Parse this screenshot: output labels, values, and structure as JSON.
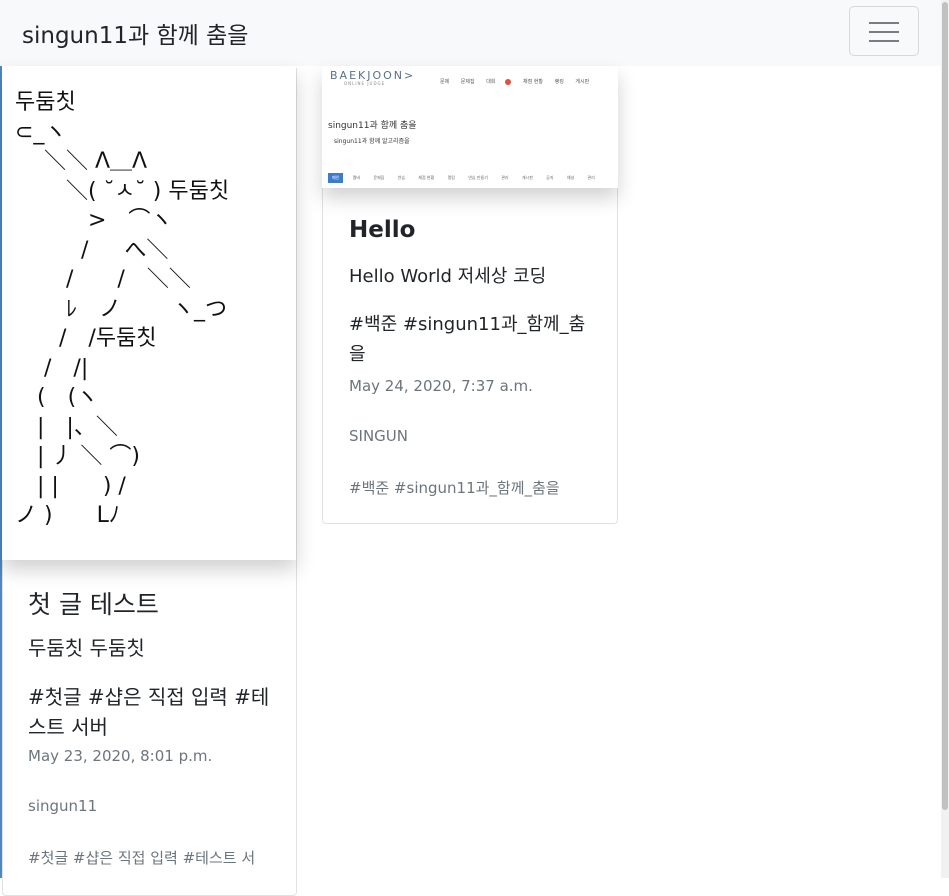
{
  "navbar": {
    "brand": "singun11과 함께 춤을",
    "toggler_icon": "hamburger-icon"
  },
  "posts": [
    {
      "image_text": "두둠칫\n⊂_ヽ\n　 ＼＼ Λ＿Λ\n　　 ＼( ˘ㅅ˘ ) 두둠칫\n　　　 >　⌒ヽ\n　　　/ 　 へ＼\n　　 /　　/　＼＼\n　　 ﾚ　ノ　　 ヽ_つ\n　　/　/두둠칫\n　 /　/|\n　(　(ヽ\n　|　|、＼\n　| 丿 ＼ ⌒)\n　| |　　) /\nノ )　　Lﾉ",
      "title": "첫 글 테스트",
      "subtitle": "두둠칫 두둠칫",
      "hashtags": "#첫글 #샵은 직접 입력 #테스트 서버",
      "date": "May 23, 2020, 8:01 p.m.",
      "author": "singun11",
      "tags": "#첫글 #샵은 직접 입력 #테스트 서"
    },
    {
      "image": {
        "logo": "BAEKJOON>",
        "logo_sub": "ONLINE JUDGE",
        "menu": [
          "문제",
          "문제집",
          "대회",
          "채점 현황",
          "랭킹",
          "게시판"
        ],
        "page_title": "singun11과 함께 춤을",
        "page_subtitle": "singun11과 함께 알고리즘을",
        "tabs": [
          "메인",
          "멤버",
          "문제집",
          "연습",
          "채점 현황",
          "랭킹",
          "연습 만들기",
          "관리",
          "게시판",
          "공지",
          "채널",
          "관리"
        ]
      },
      "title": "Hello",
      "subtitle": "Hello World 저세상 코딩",
      "hashtags": "#백준 #singun11과_함께_춤을",
      "date": "May 24, 2020, 7:37 a.m.",
      "author": "SINGUN",
      "tags": "#백준 #singun11과_함께_춤을"
    }
  ],
  "colors": {
    "navbar_bg": "#f8f9fa",
    "muted_text": "#6c757d",
    "accent_blue": "#3c7bd0"
  }
}
